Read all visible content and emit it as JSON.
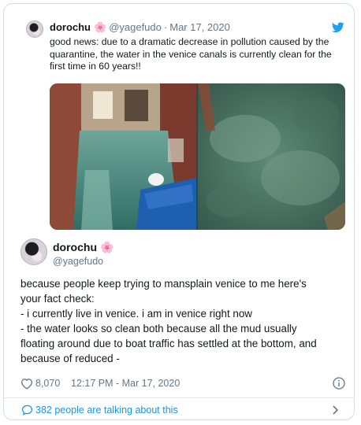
{
  "quoted_tweet": {
    "name": "dorochu",
    "name_emoji": "🌸",
    "handle": "@yagefudo",
    "separator": "·",
    "date": "Mar 17, 2020",
    "text": "good news: due to a dramatic decrease in pollution caused by the quarantine, the water in the venice canals is currently clean for the first time in 60 years!!"
  },
  "main_tweet": {
    "name": "dorochu",
    "name_emoji": "🌸",
    "handle": "@yagefudo",
    "lines": [
      "because people keep trying to mansplain venice to me here's",
      "your fact check:",
      "- i currently live in venice. i am in venice right now",
      "- the water looks so clean both because all the mud usually",
      "floating around due to boat traffic has settled at the bottom, and",
      "because of reduced -"
    ],
    "likes": "8,070",
    "timestamp": "12:17 PM - Mar 17, 2020"
  },
  "footer": {
    "talking_text": "382 people are talking about this"
  },
  "colors": {
    "link_blue": "#1b95e0",
    "twitter_blue": "#1da1f2",
    "secondary_text": "#657786",
    "border": "#d5dde3"
  },
  "icons": [
    "twitter-bird-icon",
    "heart-icon",
    "info-icon",
    "speech-bubble-icon",
    "chevron-right-icon"
  ]
}
